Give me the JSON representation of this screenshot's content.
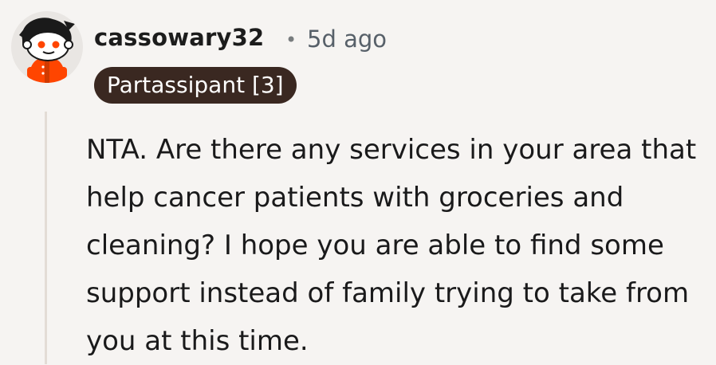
{
  "comment": {
    "username": "cassowary32",
    "separator": "•",
    "timestamp": "5d ago",
    "flair": "Partassipant [3]",
    "body": "NTA. Are there any services in your area that help cancer patients with groceries and cleaning? I hope you are able to find some support instead of family trying to take from you at this time."
  },
  "colors": {
    "background": "#f6f4f2",
    "flair_bg": "#3a2821",
    "avatar_shirt": "#ff4500",
    "thread_line": "#e3dcd6"
  },
  "icons": {
    "avatar": "snoo-avatar-icon"
  }
}
